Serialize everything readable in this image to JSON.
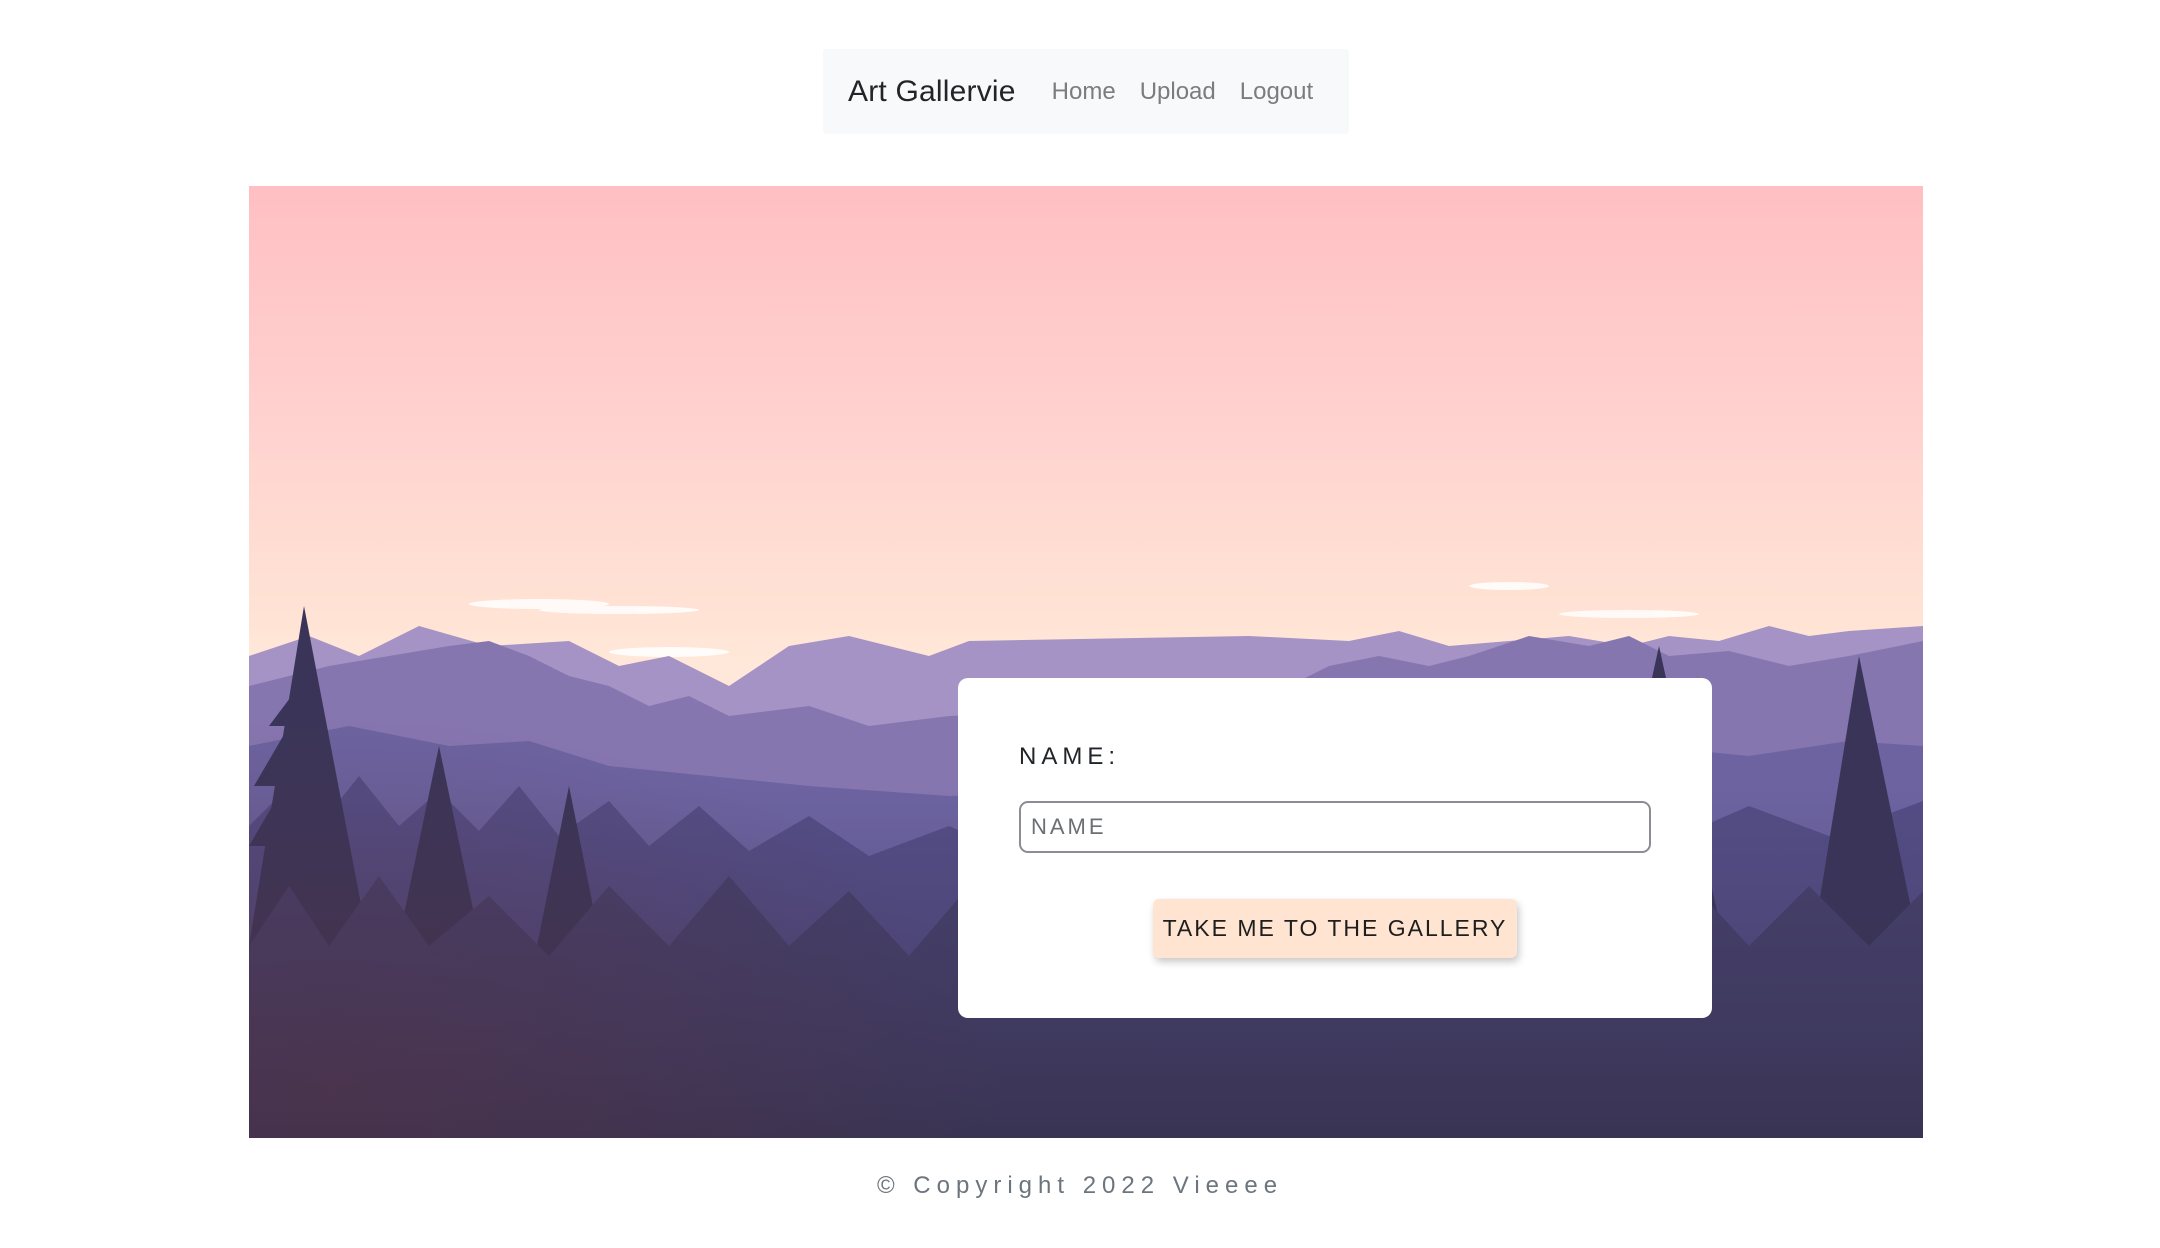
{
  "navbar": {
    "brand": "Art Gallervie",
    "links": [
      "Home",
      "Upload",
      "Logout"
    ]
  },
  "form": {
    "label": "NAME:",
    "input_placeholder": "NAME",
    "input_value": "",
    "submit_label": "TAKE ME TO THE GALLERY"
  },
  "footer": {
    "text": "© Copyright 2022 Vieeee"
  },
  "colors": {
    "navbar_bg": "#f8f9fa",
    "button_bg": "#ffe4d2",
    "sky_top": "#ffc0c4",
    "forest_dark": "#332c46"
  }
}
